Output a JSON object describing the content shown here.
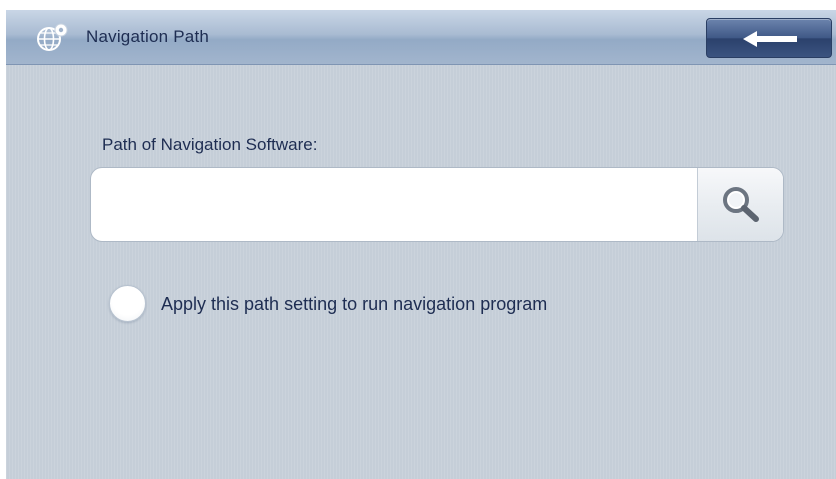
{
  "header": {
    "title": "Navigation Path",
    "title_icon": "globe-icon",
    "back_icon": "left-arrow-icon"
  },
  "path_field": {
    "label": "Path of Navigation Software:",
    "value": "",
    "placeholder": "",
    "browse_icon": "search-icon"
  },
  "apply_option": {
    "label": "Apply this path setting to run navigation program",
    "checked": false
  },
  "colors": {
    "background": "#c5ced8",
    "text": "#1e2d52",
    "header_gradient_top": "#c9d6e6",
    "back_button": "#3f5886"
  }
}
